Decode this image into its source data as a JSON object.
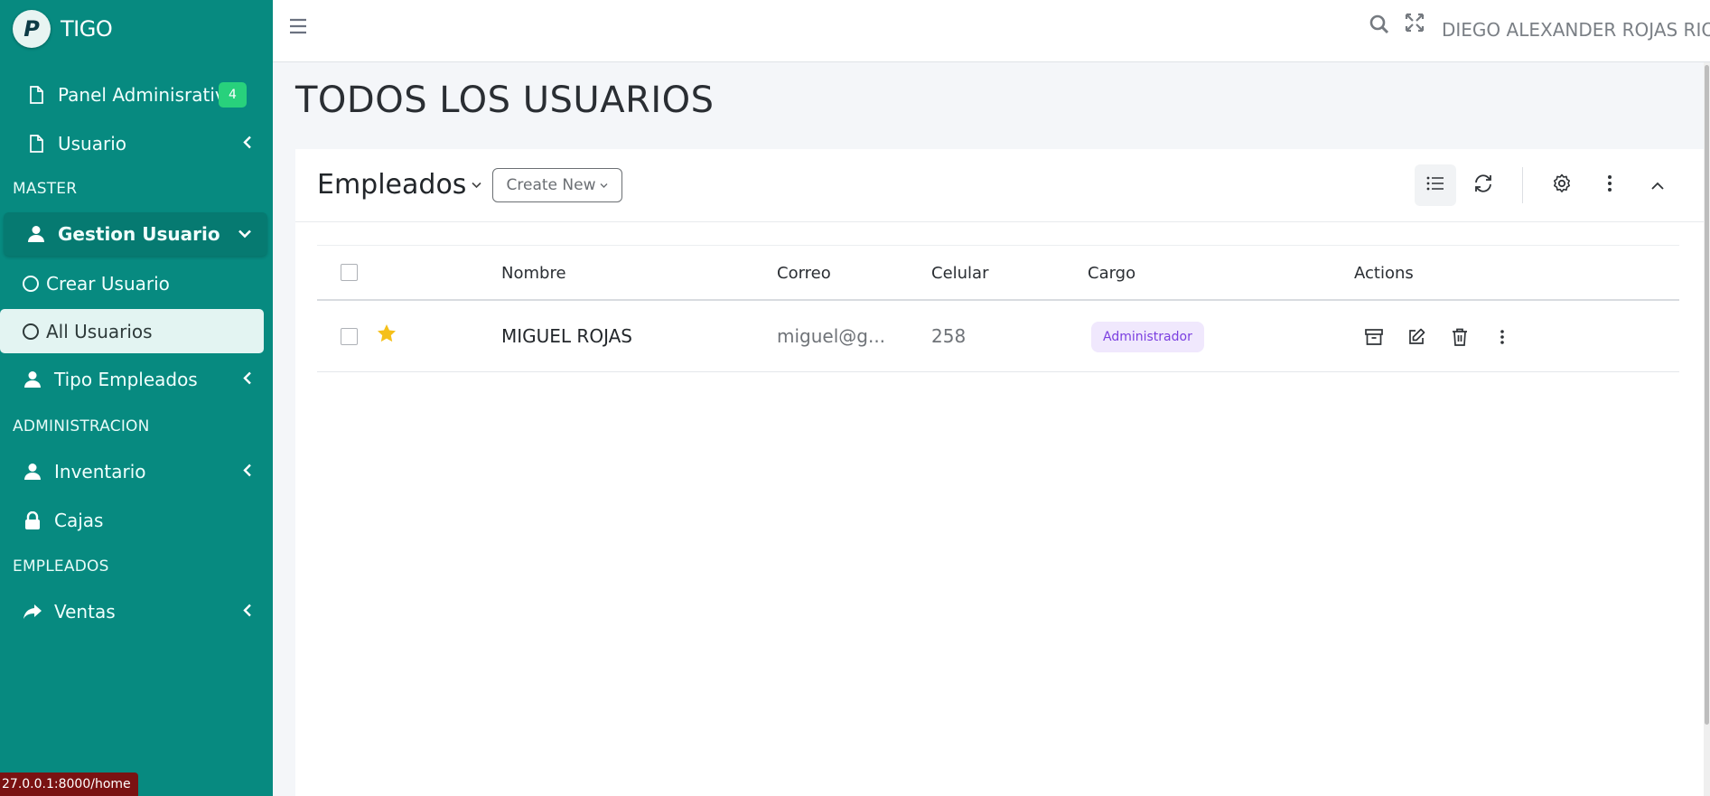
{
  "app": {
    "brand_logo_letter": "P",
    "brand_name": "TIGO"
  },
  "sidebar": {
    "items": [
      {
        "label": "Panel Adminisrativo",
        "badge": "4",
        "icon": "file-icon"
      },
      {
        "label": "Usuario",
        "icon": "file-icon"
      }
    ],
    "sections": {
      "master": "MASTER",
      "administracion": "ADMINISTRACION",
      "empleados": "EMPLEADOS"
    },
    "gestion": {
      "label": "Gestion Usuario",
      "icon": "user-icon"
    },
    "sub_items": [
      {
        "label": "Crear Usuario"
      },
      {
        "label": "All Usuarios"
      }
    ],
    "tipo_empleados": {
      "label": "Tipo Empleados",
      "icon": "user-icon"
    },
    "inventario": {
      "label": "Inventario",
      "icon": "user-icon"
    },
    "cajas": {
      "label": "Cajas",
      "icon": "lock-icon"
    },
    "ventas": {
      "label": "Ventas",
      "icon": "share-icon"
    }
  },
  "status_bar": {
    "url": "27.0.0.1:8000/home"
  },
  "topbar": {
    "user_name": "DIEGO ALEXANDER ROJAS RIOS"
  },
  "page": {
    "title": "TODOS LOS USUARIOS"
  },
  "card": {
    "title": "Empleados",
    "create_new": "Create New"
  },
  "table": {
    "columns": [
      "Nombre",
      "Correo",
      "Celular",
      "Cargo",
      "Actions"
    ],
    "rows": [
      {
        "nombre": "MIGUEL ROJAS",
        "correo": "miguel@g...",
        "celular": "258",
        "cargo": "Administrador",
        "starred": true
      }
    ]
  },
  "colors": {
    "sidebar": "#078a80",
    "badge": "#28d17c",
    "role_badge_bg": "#f0e8fd",
    "role_badge_text": "#7b3fe0",
    "star": "#f5c01a"
  }
}
